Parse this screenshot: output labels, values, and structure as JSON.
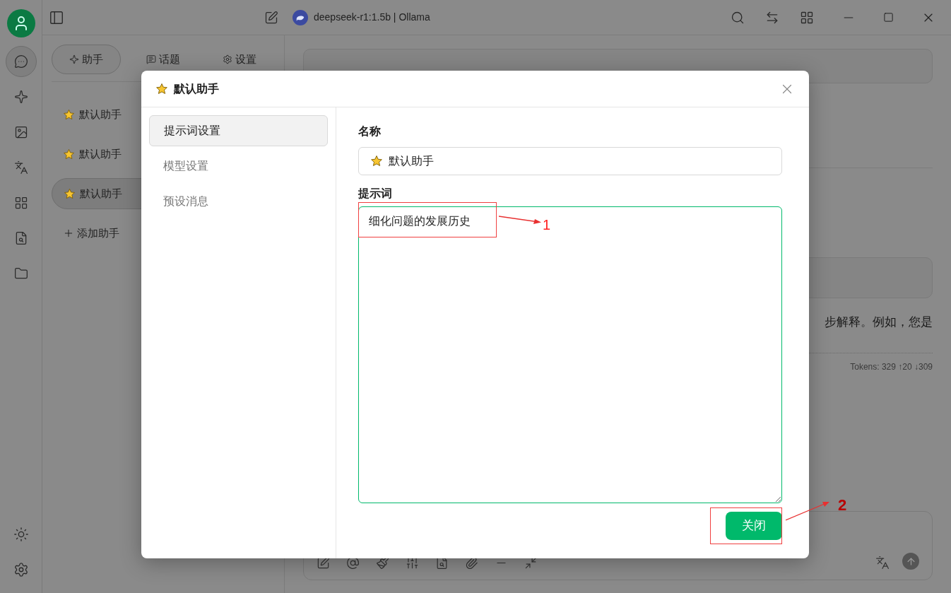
{
  "rail": [
    {
      "selected": true
    },
    {
      "selected": false
    },
    {
      "selected": false
    },
    {
      "selected": false
    },
    {
      "selected": false
    },
    {
      "selected": false
    },
    {
      "selected": false
    }
  ],
  "topbar": {
    "model_title": "deepseek-r1:1.5b | Ollama"
  },
  "sidebar": {
    "tabs": [
      {
        "label": "助手",
        "selected": true
      },
      {
        "label": "话题",
        "selected": false
      },
      {
        "label": "设置",
        "selected": false
      }
    ],
    "assistants": [
      {
        "label": "默认助手",
        "selected": false
      },
      {
        "label": "默认助手",
        "selected": false
      },
      {
        "label": "默认助手",
        "selected": true
      }
    ],
    "add_button": "添加助手"
  },
  "chat": {
    "message_text": "步解释。例如，您是",
    "tokens": "Tokens: 329 ↑20 ↓309"
  },
  "dialog": {
    "title": "默认助手",
    "nav": [
      {
        "label": "提示词设置",
        "selected": true
      },
      {
        "label": "模型设置",
        "selected": false
      },
      {
        "label": "预设消息",
        "selected": false
      }
    ],
    "name_label": "名称",
    "name_value": "默认助手",
    "prompt_label": "提示词",
    "prompt_value": "细化问题的发展历史",
    "close_button": "关闭"
  },
  "annotations": [
    {
      "label": "1"
    },
    {
      "label": "2"
    }
  ]
}
